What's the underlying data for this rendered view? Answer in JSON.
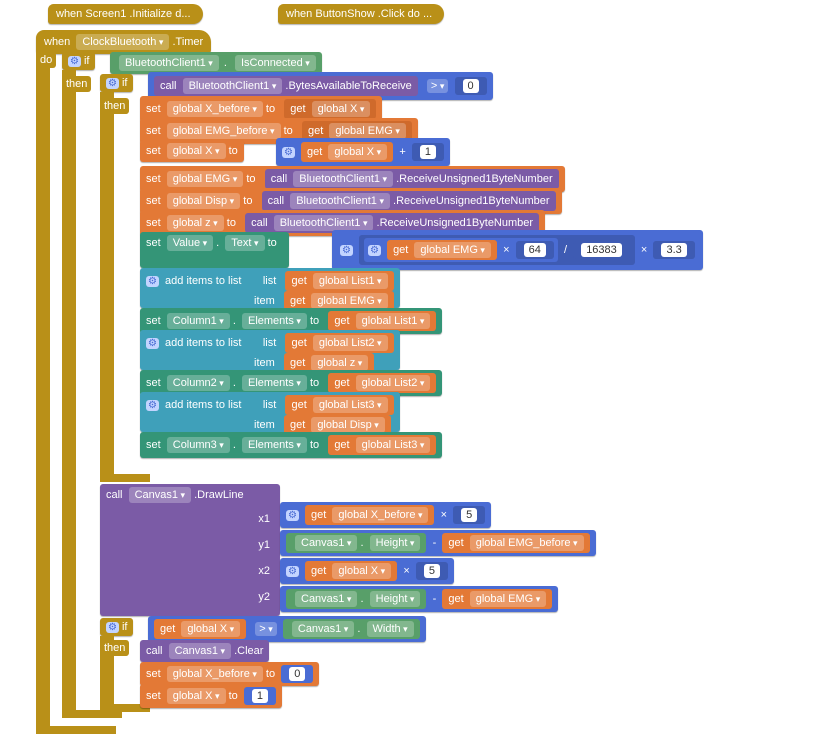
{
  "top_events": {
    "screen1_init": "when   Screen1  .Initialize d...",
    "button_show": "when   ButtonShow  .Click do ..."
  },
  "header": {
    "when": "when",
    "clock_bt": "ClockBluetooth",
    "timer": ".Timer"
  },
  "do_label": "do",
  "if1": {
    "if": "if",
    "bt_client": "BluetoothClient1",
    "dot": ".",
    "isconnected": "IsConnected"
  },
  "then1": "then",
  "if2": {
    "if": "if",
    "call": "call",
    "bt_client": "BluetoothClient1",
    "bytes": ".BytesAvailableToReceive",
    "gt": ">",
    "zero": "0"
  },
  "then2": "then",
  "rows": {
    "set_xbefore": {
      "set": "set",
      "var": "global X_before",
      "to": "to",
      "get": "get",
      "val": "global X"
    },
    "set_emgbefore": {
      "set": "set",
      "var": "global EMG_before",
      "to": "to",
      "get": "get",
      "val": "global EMG"
    },
    "set_x_inc": {
      "set": "set",
      "var": "global X",
      "to": "to",
      "get": "get",
      "val": "global X",
      "plus": "+",
      "one": "1"
    },
    "set_emg_recv": {
      "set": "set",
      "var": "global EMG",
      "to": "to",
      "call": "call",
      "bt": "BluetoothClient1",
      "recv": ".ReceiveUnsigned1ByteNumber"
    },
    "set_disp_recv": {
      "set": "set",
      "var": "global Disp",
      "to": "to",
      "call": "call",
      "bt": "BluetoothClient1",
      "recv": ".ReceiveUnsigned1ByteNumber"
    },
    "set_z_recv": {
      "set": "set",
      "var": "global z",
      "to": "to",
      "call": "call",
      "bt": "BluetoothClient1",
      "recv": ".ReceiveUnsigned1ByteNumber"
    },
    "set_value_text": {
      "set": "set",
      "value": "Value",
      "dot": ".",
      "text": "Text",
      "to": "to",
      "get": "get",
      "var": "global EMG",
      "x": "×",
      "m1": "64",
      "div": "/",
      "m2": "16383",
      "x2": "×",
      "m3": "3.3"
    },
    "add1": {
      "add": "add items to list",
      "list": "list",
      "item": "item",
      "get": "get",
      "v1": "global List1",
      "v2": "global EMG"
    },
    "set_col1": {
      "set": "set",
      "col": "Column1",
      "dot": ".",
      "elem": "Elements",
      "to": "to",
      "get": "get",
      "val": "global List1"
    },
    "add2": {
      "add": "add items to list",
      "list": "list",
      "item": "item",
      "get": "get",
      "v1": "global List2",
      "v2": "global z"
    },
    "set_col2": {
      "set": "set",
      "col": "Column2",
      "dot": ".",
      "elem": "Elements",
      "to": "to",
      "get": "get",
      "val": "global List2"
    },
    "add3": {
      "add": "add items to list",
      "list": "list",
      "item": "item",
      "get": "get",
      "v1": "global List3",
      "v2": "global Disp"
    },
    "set_col3": {
      "set": "set",
      "col": "Column3",
      "dot": ".",
      "elem": "Elements",
      "to": "to",
      "get": "get",
      "val": "global List3"
    }
  },
  "drawline": {
    "call": "call",
    "canvas": "Canvas1",
    "dl": ".DrawLine",
    "x1": "x1",
    "y1": "y1",
    "x2": "x2",
    "y2": "y2",
    "get": "get",
    "xbefore": "global X_before",
    "five": "5",
    "canvas2": "Canvas1",
    "height": "Height",
    "minus": "-",
    "emgbefore": "global EMG_before",
    "gx": "global X",
    "gemg": "global EMG",
    "mult": "×"
  },
  "if3": {
    "if": "if",
    "get": "get",
    "gx": "global X",
    "gt": ">",
    "canvas": "Canvas1",
    "dot": ".",
    "width": "Width"
  },
  "then3": {
    "then": "then",
    "call": "call",
    "canvas": "Canvas1",
    "clear": ".Clear",
    "set": "set",
    "xbefore": "global X_before",
    "to": "to",
    "zero": "0",
    "gx": "global X",
    "one": "1"
  }
}
